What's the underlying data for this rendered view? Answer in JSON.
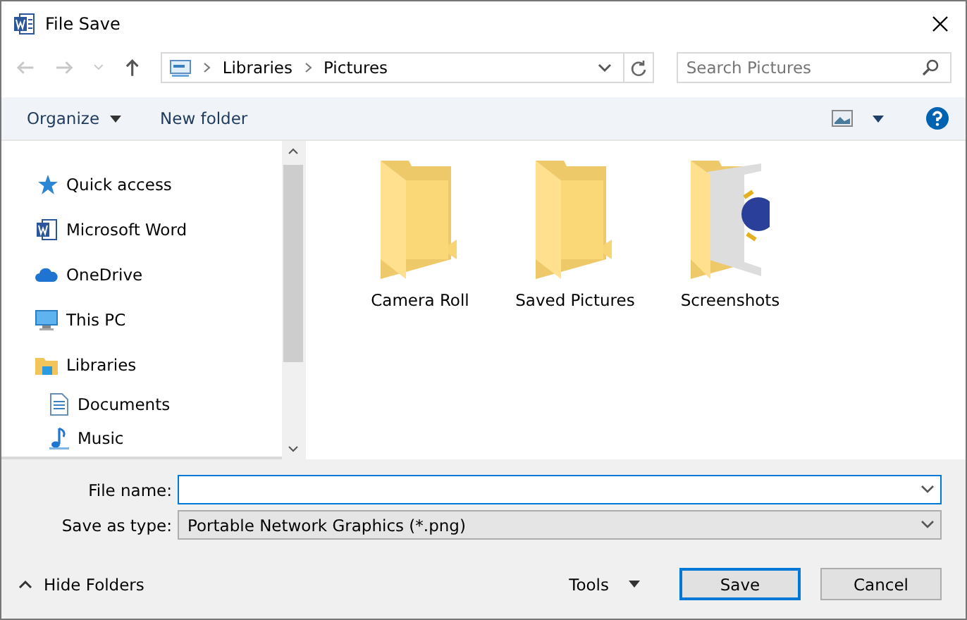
{
  "window": {
    "title": "File Save"
  },
  "address": {
    "crumbs": [
      "Libraries",
      "Pictures"
    ]
  },
  "search": {
    "placeholder": "Search Pictures"
  },
  "toolbar": {
    "organize": "Organize",
    "new_folder": "New folder"
  },
  "sidebar": {
    "items": [
      {
        "label": "Quick access",
        "kind": "star"
      },
      {
        "label": "Microsoft Word",
        "kind": "word"
      },
      {
        "label": "OneDrive",
        "kind": "cloud"
      },
      {
        "label": "This PC",
        "kind": "pc"
      },
      {
        "label": "Libraries",
        "kind": "library",
        "children": [
          {
            "label": "Documents",
            "kind": "doc"
          },
          {
            "label": "Music",
            "kind": "music"
          }
        ]
      }
    ]
  },
  "folders": [
    {
      "name": "Camera Roll",
      "kind": "plain"
    },
    {
      "name": "Saved Pictures",
      "kind": "plain"
    },
    {
      "name": "Screenshots",
      "kind": "image"
    }
  ],
  "form": {
    "file_name_label": "File name:",
    "type_label": "Save as type:",
    "type_value": "Portable Network Graphics (*.png)"
  },
  "footer": {
    "hide_folders": "Hide Folders",
    "tools": "Tools",
    "save": "Save",
    "cancel": "Cancel"
  }
}
